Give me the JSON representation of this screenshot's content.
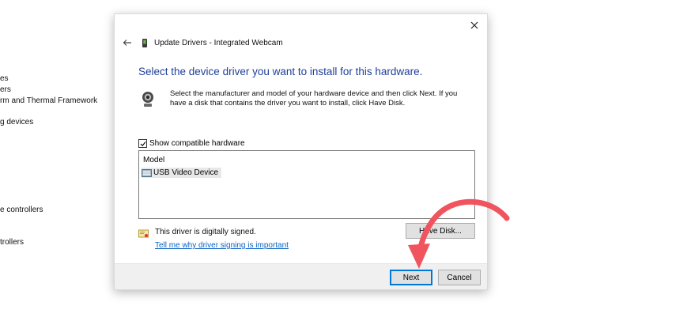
{
  "background_tree": {
    "items": [
      "es",
      "ers",
      "rm and Thermal Framework",
      "g devices",
      "e controllers",
      "trollers"
    ]
  },
  "dialog": {
    "title": "Update Drivers - Integrated Webcam",
    "heading": "Select the device driver you want to install for this hardware.",
    "description": "Select the manufacturer and model of your hardware device and then click Next. If you have a disk that contains the driver you want to install, click Have Disk.",
    "show_compatible_label": "Show compatible hardware",
    "show_compatible_checked": true,
    "list": {
      "header": "Model",
      "items": [
        "USB Video Device"
      ]
    },
    "signed_text": "This driver is digitally signed.",
    "signing_link": "Tell me why driver signing is important",
    "have_disk_label": "Have Disk...",
    "next_label": "Next",
    "cancel_label": "Cancel"
  },
  "colors": {
    "heading": "#1f3f9a",
    "link": "#0b62c4",
    "annotation_arrow": "#f0555f",
    "default_button_border": "#0078d7"
  },
  "icons": {
    "close": "close-icon",
    "back": "back-arrow-icon",
    "device": "device-icon",
    "webcam": "webcam-icon",
    "driver": "driver-icon",
    "certificate": "certificate-icon",
    "annotation": "curved-arrow-icon"
  }
}
